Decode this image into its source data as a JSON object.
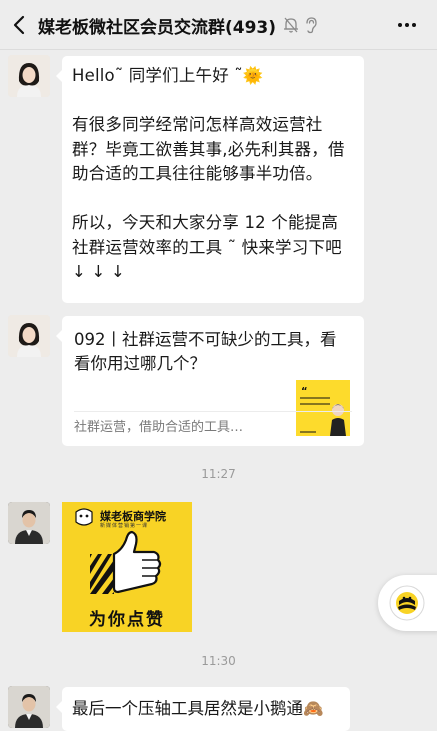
{
  "header": {
    "title": "媒老板微社区会员交流群(493)"
  },
  "messages": {
    "first": {
      "lines": [
        "Hello˜ 同学们上午好 ˜🌞",
        "有很多同学经常问怎样高效运营社",
        "群？毕竟工欲善其事,必先利其器，借",
        "助合适的工具往往能够事半功倍。",
        "所以，今天和大家分享 12 个能提高",
        "社群运营效率的工具 ˜ 快来学习下吧",
        "↓ ↓ ↓"
      ]
    },
    "link_card": {
      "title": "092丨社群运营不可缺少的工具，看看你用过哪几个？",
      "description": "社群运营，借助合适的工具…",
      "thumb_line1": "一天一个营销话题",
      "thumb_line2": "一年一个翻转自己"
    },
    "time1": "11:27",
    "sticker": {
      "brand": "媒老板商学院",
      "subtitle": "新媒体营销第一课",
      "text": "为你点赞"
    },
    "time2": "11:30",
    "last": {
      "text": "最后一个压轴工具居然是小鹅通🙈"
    }
  },
  "colors": {
    "background": "#ededed",
    "bubble": "#ffffff",
    "sticker_yellow": "#f8d325",
    "timestamp": "#9a9a9a"
  },
  "icons": {
    "back": "chevron-left-icon",
    "mute": "bell-off-icon",
    "ear": "ear-icon",
    "more": "more-dots-icon",
    "float": "bee-icon"
  }
}
